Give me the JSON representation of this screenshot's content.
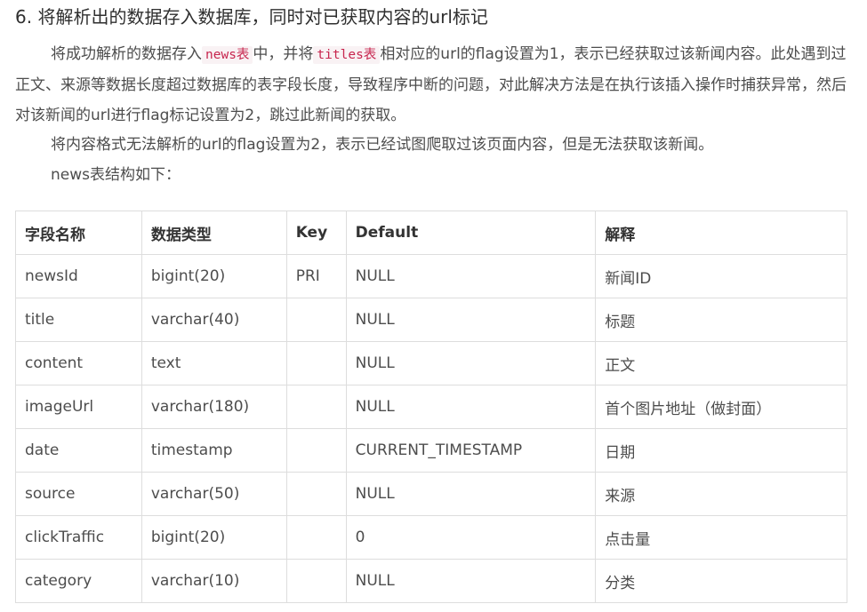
{
  "heading": "6. 将解析出的数据存入数据库，同时对已获取内容的url标记",
  "paragraph1": {
    "text_a": "将成功解析的数据存入",
    "code_a": "news表",
    "text_b": "中，并将",
    "code_b": "titles表",
    "text_c": "相对应的url的flag设置为1，表示已经获取过该新闻内容。此处遇到过正文、来源等数据长度超过数据库的表字段长度，导致程序中断的问题，对此解决方法是在执行该插入操作时捕获异常，然后对该新闻的url进行flag标记设置为2，跳过此新闻的获取。"
  },
  "paragraph2": "将内容格式无法解析的url的flag设置为2，表示已经试图爬取过该页面内容，但是无法获取该新闻。",
  "paragraph3": "news表结构如下：",
  "table": {
    "headers": [
      "字段名称",
      "数据类型",
      "Key",
      "Default",
      "解释"
    ],
    "rows": [
      [
        "newsId",
        "bigint(20)",
        "PRI",
        "NULL",
        "新闻ID"
      ],
      [
        "title",
        "varchar(40)",
        "",
        "NULL",
        "标题"
      ],
      [
        "content",
        "text",
        "",
        "NULL",
        "正文"
      ],
      [
        "imageUrl",
        "varchar(180)",
        "",
        "NULL",
        "首个图片地址（做封面）"
      ],
      [
        "date",
        "timestamp",
        "",
        "CURRENT_TIMESTAMP",
        "日期"
      ],
      [
        "source",
        "varchar(50)",
        "",
        "NULL",
        "来源"
      ],
      [
        "clickTraffic",
        "bigint(20)",
        "",
        "0",
        "点击量"
      ],
      [
        "category",
        "varchar(10)",
        "",
        "NULL",
        "分类"
      ]
    ]
  }
}
